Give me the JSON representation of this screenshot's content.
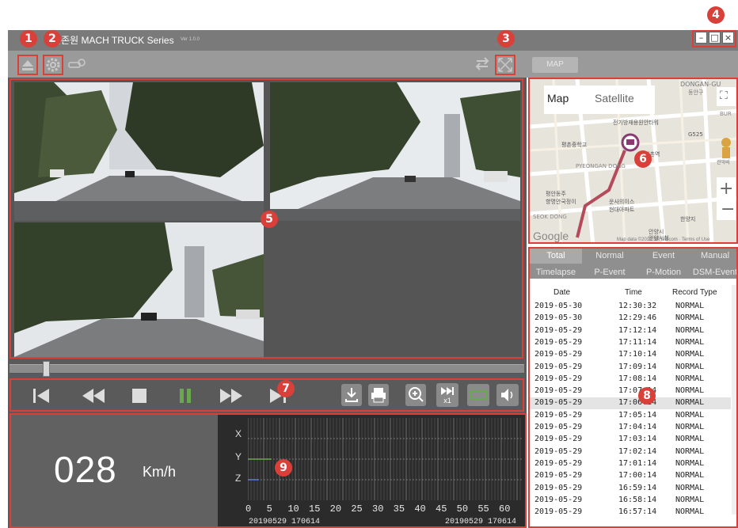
{
  "window": {
    "title": "츤존원 MACH TRUCK Series",
    "version": "Ver 1.0.0",
    "minimize": "–",
    "maximize": "□",
    "close": "×"
  },
  "toolbar": {
    "icons": [
      "eject-icon",
      "gear-icon",
      "car-search-icon",
      "swap-icon",
      "fullscreen-icon"
    ],
    "map_tab": "MAP"
  },
  "map": {
    "type_map": "Map",
    "type_satellite": "Satellite",
    "zoom_in": "+",
    "zoom_out": "−",
    "fullscreen": "⛶",
    "google_label": "Google",
    "copyright": "Map data ©2019 SK telecom · Terms of Use",
    "place_labels": [
      "DONGAN-GU",
      "동안구",
      "G525",
      "전기방재용원안타워",
      "평촌중학교",
      "평촌역",
      "PYEONGAN DONG",
      "안양시",
      "안양시청",
      "BUR",
      "관악비",
      "평안동주",
      "향명안국정이",
      "운사의이스",
      "현대아파트",
      "한양지",
      "SEOK DONG"
    ]
  },
  "record_tabs": {
    "row1": [
      "Total",
      "Normal",
      "Event",
      "Manual"
    ],
    "row2": [
      "Timelapse",
      "P-Event",
      "P-Motion",
      "DSM-Event"
    ],
    "active": "Total"
  },
  "record_table": {
    "columns": [
      "Date",
      "Time",
      "Record Type"
    ],
    "rows": [
      [
        "2019-05-30",
        "12:30:32",
        "NORMAL"
      ],
      [
        "2019-05-30",
        "12:29:46",
        "NORMAL"
      ],
      [
        "2019-05-29",
        "17:12:14",
        "NORMAL"
      ],
      [
        "2019-05-29",
        "17:11:14",
        "NORMAL"
      ],
      [
        "2019-05-29",
        "17:10:14",
        "NORMAL"
      ],
      [
        "2019-05-29",
        "17:09:14",
        "NORMAL"
      ],
      [
        "2019-05-29",
        "17:08:14",
        "NORMAL"
      ],
      [
        "2019-05-29",
        "17:07:14",
        "NORMAL"
      ],
      [
        "2019-05-29",
        "17:06:14",
        "NORMAL"
      ],
      [
        "2019-05-29",
        "17:05:14",
        "NORMAL"
      ],
      [
        "2019-05-29",
        "17:04:14",
        "NORMAL"
      ],
      [
        "2019-05-29",
        "17:03:14",
        "NORMAL"
      ],
      [
        "2019-05-29",
        "17:02:14",
        "NORMAL"
      ],
      [
        "2019-05-29",
        "17:01:14",
        "NORMAL"
      ],
      [
        "2019-05-29",
        "17:00:14",
        "NORMAL"
      ],
      [
        "2019-05-29",
        "16:59:14",
        "NORMAL"
      ],
      [
        "2019-05-29",
        "16:58:14",
        "NORMAL"
      ],
      [
        "2019-05-29",
        "16:57:14",
        "NORMAL"
      ]
    ],
    "selected_row": 8
  },
  "playback": {
    "seek_fraction": 0.07,
    "speed_badge": "x1"
  },
  "speed": {
    "value": "028",
    "unit": "Km/h"
  },
  "gsensor": {
    "axes": [
      "X",
      "Y",
      "Z"
    ],
    "ticks": [
      "0",
      "5",
      "10",
      "15",
      "20",
      "25",
      "30",
      "35",
      "40",
      "45",
      "50",
      "55",
      "60"
    ],
    "start_time": "20190529 170614",
    "end_time": "20190529 170614"
  },
  "callouts": [
    "1",
    "2",
    "3",
    "4",
    "5",
    "6",
    "7",
    "8",
    "9"
  ],
  "colors": {
    "callout": "#d9403a",
    "titlebar": "#7a7a7a",
    "panel": "#5a5a5a",
    "play_accent": "#6aa84f"
  }
}
